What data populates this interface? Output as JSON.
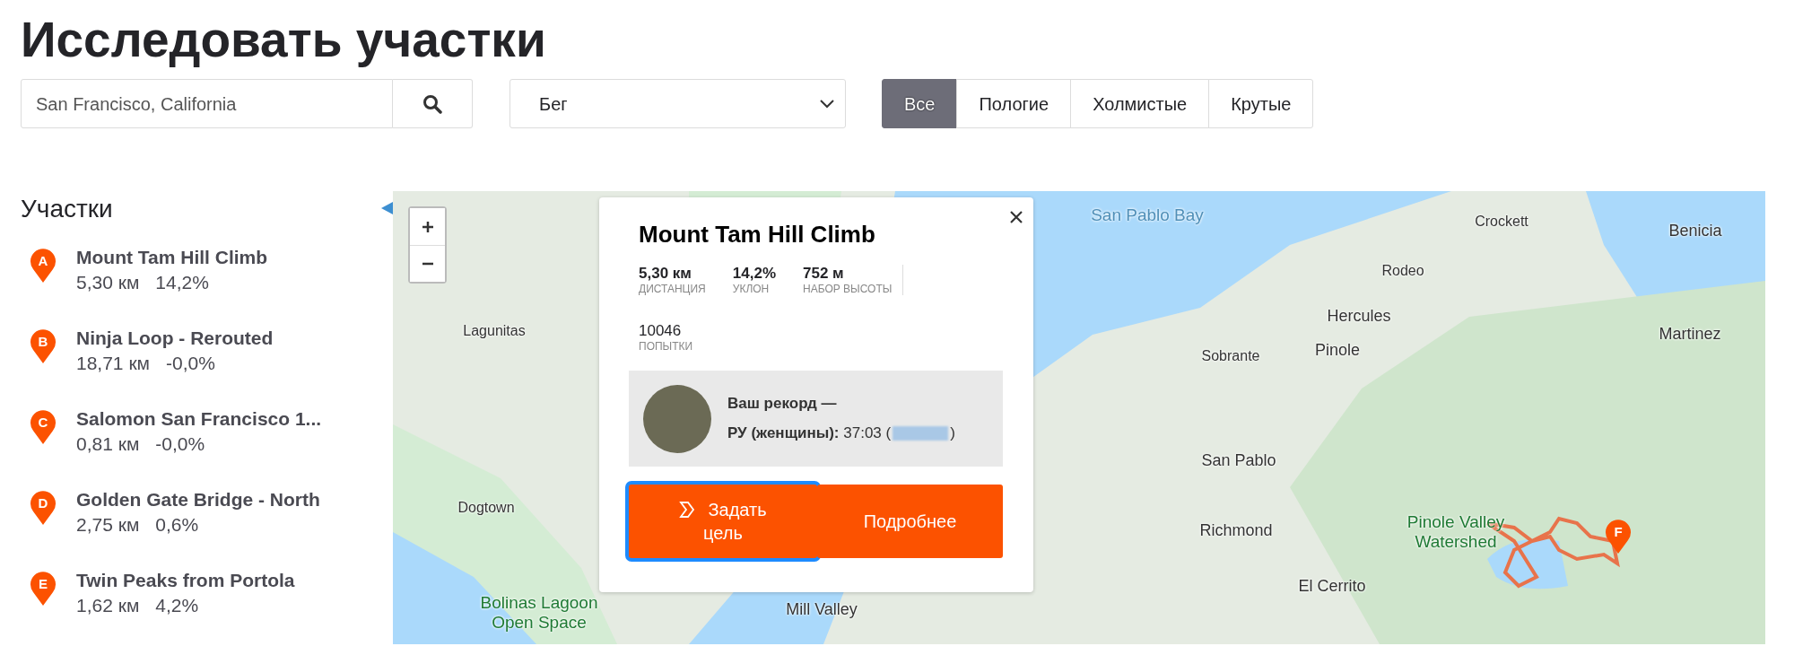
{
  "page": {
    "title": "Исследовать участки"
  },
  "filters": {
    "search": {
      "value": "San Francisco, California"
    },
    "sport": {
      "value": "Бег"
    },
    "terrain": [
      {
        "label": "Все",
        "selected": true
      },
      {
        "label": "Пологие",
        "selected": false
      },
      {
        "label": "Холмистые",
        "selected": false
      },
      {
        "label": "Крутые",
        "selected": false
      }
    ]
  },
  "sidebar": {
    "title": "Участки",
    "segments": [
      {
        "letter": "A",
        "name": "Mount Tam Hill Climb",
        "distance": "5,30 км",
        "grade": "14,2%"
      },
      {
        "letter": "B",
        "name": "Ninja Loop - Rerouted",
        "distance": "18,71 км",
        "grade": "-0,0%"
      },
      {
        "letter": "C",
        "name": "Salomon San Francisco 1...",
        "distance": "0,81 км",
        "grade": "-0,0%"
      },
      {
        "letter": "D",
        "name": "Golden Gate Bridge - North",
        "distance": "2,75 км",
        "grade": "0,6%"
      },
      {
        "letter": "E",
        "name": "Twin Peaks from Portola",
        "distance": "1,62 км",
        "grade": "4,2%"
      }
    ]
  },
  "map": {
    "labels": [
      {
        "text": "Lagunitas",
        "kind": "place"
      },
      {
        "text": "Dogtown",
        "kind": "place"
      },
      {
        "text": "Bolinas Lagoon Open Space",
        "kind": "park"
      },
      {
        "text": "San Pablo Bay",
        "kind": "water"
      },
      {
        "text": "Crockett",
        "kind": "place"
      },
      {
        "text": "Benicia",
        "kind": "city"
      },
      {
        "text": "Rodeo",
        "kind": "place"
      },
      {
        "text": "Hercules",
        "kind": "city"
      },
      {
        "text": "Sobrante",
        "kind": "place"
      },
      {
        "text": "Pinole",
        "kind": "city"
      },
      {
        "text": "Martinez",
        "kind": "city"
      },
      {
        "text": "San Pablo",
        "kind": "city"
      },
      {
        "text": "Richmond",
        "kind": "city"
      },
      {
        "text": "El Cerrito",
        "kind": "city"
      },
      {
        "text": "Pinole Valley Watershed",
        "kind": "park"
      },
      {
        "text": "Mill Valley",
        "kind": "city"
      }
    ],
    "markers": [
      {
        "letter": "F"
      }
    ]
  },
  "popup": {
    "title": "Mount Tam Hill Climb",
    "stats": [
      {
        "value": "5,30 км",
        "label": "ДИСТАНЦИЯ"
      },
      {
        "value": "14,2%",
        "label": "УКЛОН"
      },
      {
        "value": "752 м",
        "label": "НАБОР ВЫСОТЫ"
      }
    ],
    "attempts": {
      "value": "10046",
      "label": "ПОПЫТКИ"
    },
    "record": {
      "heading": "Ваш рекорд —",
      "line": "**РУ (женщины):** 37:03 (",
      "line_end": ")"
    },
    "buttons": [
      {
        "label": "Задать цель",
        "kind": "goal",
        "focused": true
      },
      {
        "label": "Подробнее",
        "kind": "details",
        "focused": false
      }
    ]
  }
}
